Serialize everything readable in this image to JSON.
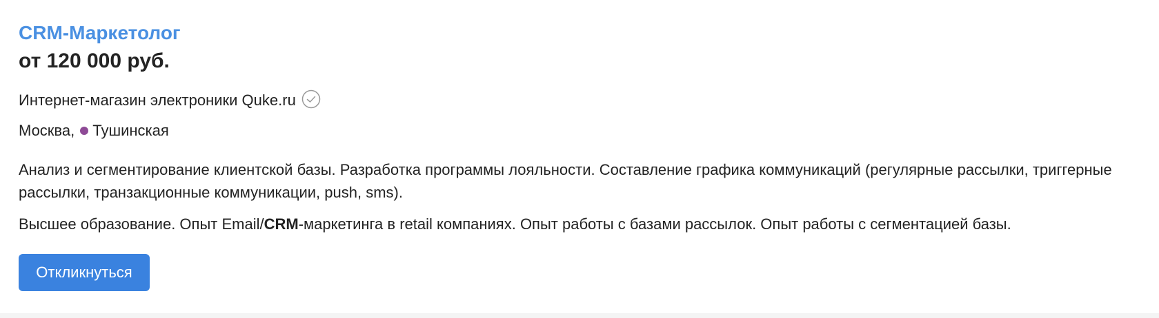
{
  "vacancy": {
    "title": "CRM-Маркетолог",
    "salary": "от 120 000 руб.",
    "company": "Интернет-магазин электроники Quke.ru",
    "city": "Москва,",
    "metro": "Тушинская",
    "description": "Анализ и сегментирование клиентской базы. Разработка программы лояльности. Составление графика коммуникаций (регулярные рассылки, триггерные рассылки, транзакционные коммуникации, push, sms).",
    "requirements": {
      "before": "Высшее образование. Опыт Email/",
      "highlight": "CRM",
      "after": "-маркетинга в retail компаниях. Опыт работы с базами рассылок. Опыт работы с сегментацией базы."
    },
    "respond_label": "Откликнуться"
  },
  "icons": {
    "verified": "check-circle-icon"
  },
  "colors": {
    "title": "#4a90e2",
    "button": "#3a82df",
    "metro_line": "#8e4a96",
    "text": "#232323"
  }
}
